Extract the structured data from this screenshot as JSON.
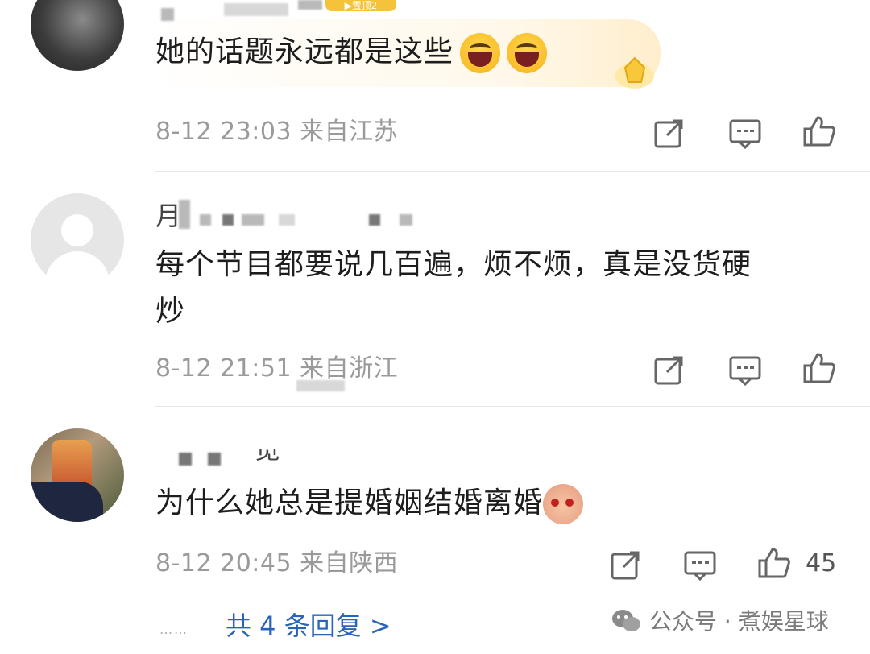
{
  "comments": [
    {
      "badge": "▶置顶2",
      "text": "她的话题永远都是这些",
      "meta": "8-12 23:03 来自江苏",
      "emojis": [
        "laugh-emoji",
        "laugh-emoji"
      ],
      "like_count": ""
    },
    {
      "name_partial": "月",
      "text_line1": "每个节目都要说几百遍，烦不烦，真是没货硬",
      "text_line2": "炒",
      "meta": "8-12 21:51 来自浙江",
      "like_count": ""
    },
    {
      "name_partial": "览",
      "text": "为什么她总是提婚姻结婚离婚",
      "meta": "8-12 20:45 来自陕西",
      "like_count": "45"
    }
  ],
  "replies": {
    "dots": "……",
    "label": "共 4 条回复 >"
  },
  "watermark": {
    "text": "公众号 · 煮娱星球",
    "icon": "wechat-icon"
  },
  "colors": {
    "link": "#2a64b8",
    "meta": "#9a9a9a",
    "badge": "#f5c33a"
  }
}
